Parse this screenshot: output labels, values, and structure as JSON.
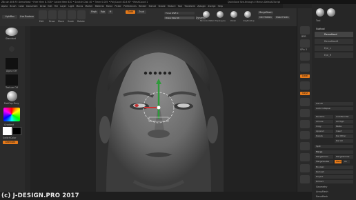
{
  "titlebar": {
    "text": "ZBrush 4R8 P2   DemoHead   • Free Mem 8.7GB • Active Mem 620 • Scratch Disk 40 • Timer 0.005 • PolyCount 40.8 KP • MeshCount 1",
    "right": "QuickSave   See-through 0   Menus   DefaultZScript"
  },
  "menubar": [
    "Alpha",
    "Brush",
    "Color",
    "Document",
    "Draw",
    "Edit",
    "File",
    "Layer",
    "Light",
    "Macro",
    "Marker",
    "Material",
    "Movie",
    "Picker",
    "Preferences",
    "Render",
    "Stencil",
    "Stroke",
    "Texture",
    "Tool",
    "Transform",
    "Zplugin",
    "Zscript",
    "Help"
  ],
  "toolbar": {
    "lightbox": "LightBox",
    "live_boolean": "Live Boolean",
    "edit": "Edit",
    "draw": "Draw",
    "move": "Move",
    "scale": "Scale",
    "rotate": "Rotate",
    "mrgb": "Mrgb",
    "rgb": "Rgb",
    "m": "M",
    "zadd": "Zadd",
    "zsub": "Zsub",
    "focal_shift": "Focal Shift 0",
    "draw_size": "Draw Size 64",
    "dynamic": "Dynamic",
    "mirror_weld": "MirrorAndWeld",
    "del_hidden": "Del Hidden",
    "close_holes": "Close Holes",
    "merge_down": "MergeDown",
    "shelf_icons": [
      "MirrorAndWeld",
      "Topologica",
      "Polish",
      "ClayBuildup",
      "Merge"
    ],
    "colors": {
      "accent": "#e67a1a"
    }
  },
  "leftpanel": {
    "standard": "Standard",
    "alpha": "Alpha Off",
    "texture": "Texture Off",
    "material": "MatCap Gray",
    "gradient": "Gradient",
    "switch_color": "SwitchColor",
    "alternate": "Alternate"
  },
  "shelf": {
    "labels": [
      "BPR",
      "SPix 3",
      "Persp",
      "Floor",
      "Local",
      "L.Sym",
      "Gxyz",
      "Frame",
      "Move",
      "Scale",
      "Rotate",
      "PolyF",
      "Transp",
      "Solo",
      "Xpose"
    ]
  },
  "rightpanel": {
    "header": "Tool",
    "subtool": "Subtool",
    "items": [
      "DemoHead",
      "DemoHead1",
      "Eye_L",
      "Eye_R"
    ],
    "rows": [
      "List All",
      "Auto Collapse",
      "Rename",
      "AutoReorder",
      "All Low",
      "All High",
      "Copy",
      "Paste",
      "Append",
      "Insert",
      "Delete",
      "Del Other",
      "Del All",
      "Split",
      "Merge",
      "MergeDown",
      "MergeSimilar",
      "MergeVisible",
      "Weld",
      "Uv",
      "Boolean",
      "Remesh",
      "Project",
      "Extract",
      "Geometry",
      "ArrayMesh",
      "NanoMesh"
    ]
  },
  "watermark": "(c) J-DESIGN.PRO  2017"
}
